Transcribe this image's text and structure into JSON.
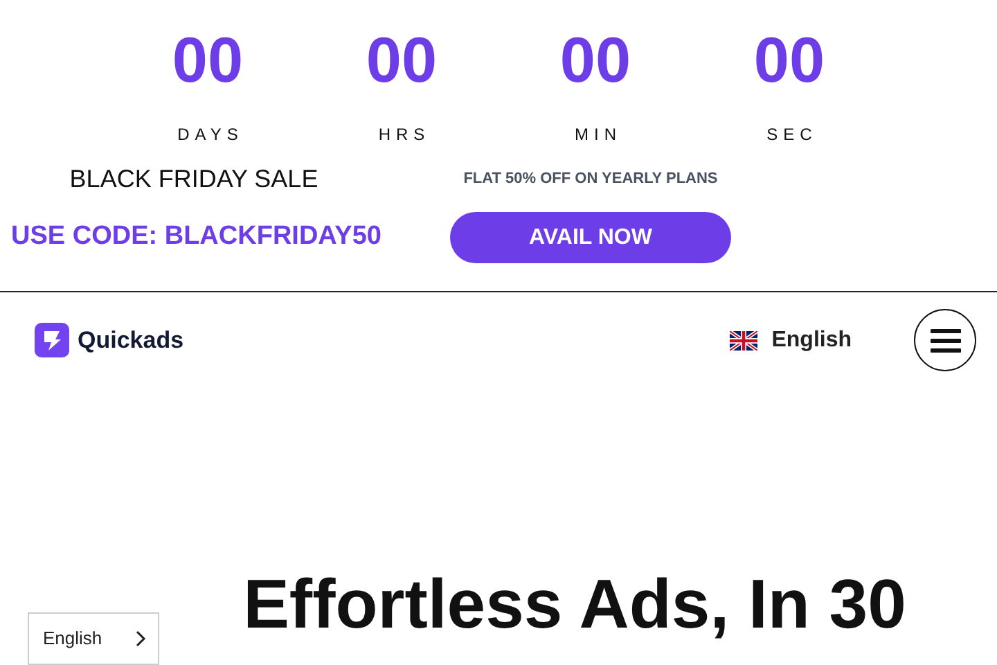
{
  "countdown": [
    {
      "value": "00",
      "unit": "DAYS"
    },
    {
      "value": "00",
      "unit": "HRS"
    },
    {
      "value": "00",
      "unit": "MIN"
    },
    {
      "value": "00",
      "unit": "SEC"
    }
  ],
  "promo": {
    "title": "BLACK FRIDAY SALE",
    "offer": "FLAT 50% OFF ON YEARLY PLANS",
    "code": "USE CODE: BLACKFRIDAY50",
    "button": "AVAIL NOW"
  },
  "header": {
    "logo": "Quickads",
    "language": "English"
  },
  "hero": {
    "heading": "Effortless Ads, In 30"
  },
  "language_switcher": {
    "label": "English"
  }
}
